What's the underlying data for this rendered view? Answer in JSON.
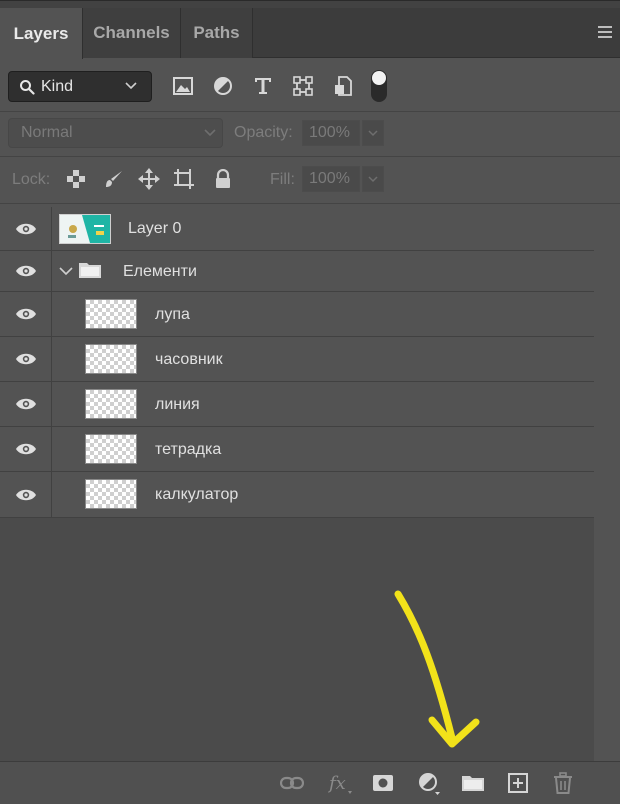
{
  "tabs": [
    {
      "label": "Layers",
      "active": true
    },
    {
      "label": "Channels",
      "active": false
    },
    {
      "label": "Paths",
      "active": false
    }
  ],
  "filter": {
    "kind_label": "Kind",
    "icons": [
      "image-filter-icon",
      "adjustment-filter-icon",
      "type-filter-icon",
      "shape-filter-icon",
      "smart-object-filter-icon",
      "filter-toggle"
    ]
  },
  "blend": {
    "mode": "Normal",
    "opacity_label": "Opacity:",
    "opacity_value": "100%"
  },
  "lock": {
    "label": "Lock:",
    "fill_label": "Fill:",
    "fill_value": "100%"
  },
  "layers": [
    {
      "name": "Layer 0",
      "type": "image",
      "visible": true
    },
    {
      "name": "Елементи",
      "type": "group",
      "visible": true,
      "expanded": true
    },
    {
      "name": "лупа",
      "type": "layer",
      "visible": true
    },
    {
      "name": "часовник",
      "type": "layer",
      "visible": true
    },
    {
      "name": "линия",
      "type": "layer",
      "visible": true
    },
    {
      "name": "тетрадка",
      "type": "layer",
      "visible": true
    },
    {
      "name": "калкулатор",
      "type": "layer",
      "visible": true
    }
  ],
  "bottom_bar": [
    "link-layers-icon",
    "fx-icon",
    "add-mask-icon",
    "adjustment-layer-icon",
    "new-group-icon",
    "new-layer-icon",
    "delete-icon"
  ],
  "colors": {
    "panel": "#535353",
    "annotation_arrow": "#f2e21a",
    "banner_teal": "#1fb5a5"
  }
}
